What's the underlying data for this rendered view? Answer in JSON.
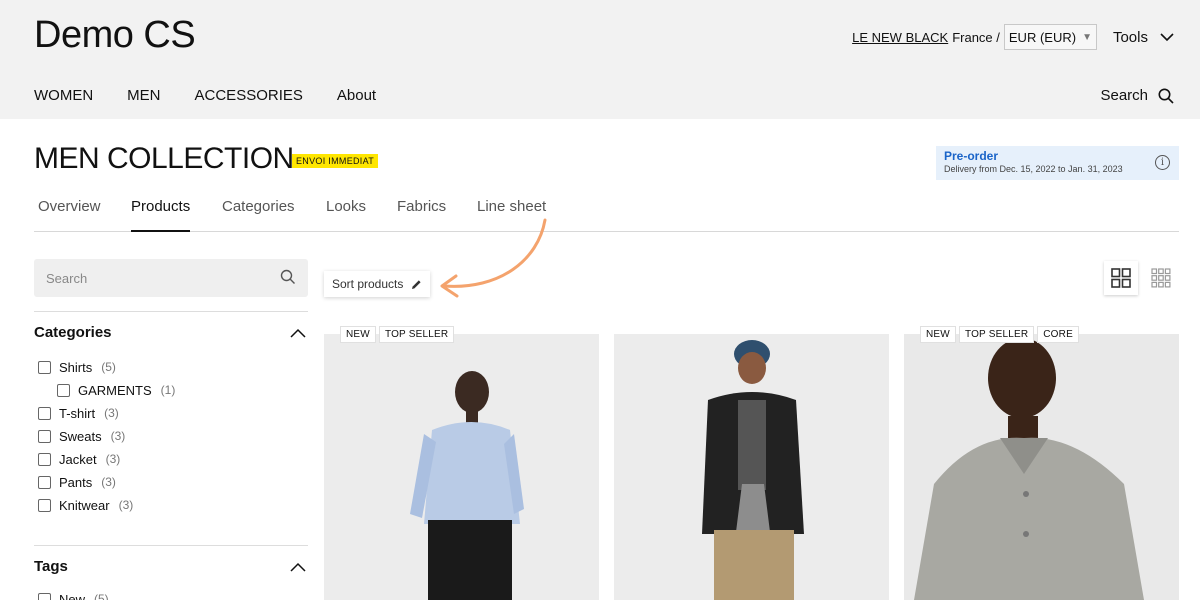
{
  "header": {
    "logo": "Demo CS",
    "brand_link": "LE NEW BLACK",
    "country": "France /",
    "currency": "EUR (EUR)",
    "tools_label": "Tools",
    "nav": [
      "WOMEN",
      "MEN",
      "ACCESSORIES",
      "About"
    ],
    "search_label": "Search"
  },
  "page": {
    "title": "MEN COLLECTION",
    "badge": "ENVOI IMMEDIAT",
    "preorder_title": "Pre-order",
    "preorder_text": "Delivery from Dec. 15, 2022 to Jan. 31, 2023"
  },
  "tabs": {
    "items": [
      "Overview",
      "Products",
      "Categories",
      "Looks",
      "Fabrics",
      "Line sheet"
    ],
    "active": "Products"
  },
  "sidebar": {
    "search_placeholder": "Search",
    "categories_title": "Categories",
    "categories": [
      {
        "label": "Shirts",
        "count": "(5)"
      },
      {
        "label": "GARMENTS",
        "count": "(1)"
      },
      {
        "label": "T-shirt",
        "count": "(3)"
      },
      {
        "label": "Sweats",
        "count": "(3)"
      },
      {
        "label": "Jacket",
        "count": "(3)"
      },
      {
        "label": "Pants",
        "count": "(3)"
      },
      {
        "label": "Knitwear",
        "count": "(3)"
      }
    ],
    "tags_title": "Tags",
    "tags": [
      {
        "label": "New",
        "count": "(5)"
      }
    ]
  },
  "toolbar": {
    "sort_label": "Sort products"
  },
  "products": [
    {
      "badges": [
        "NEW",
        "TOP SELLER"
      ]
    },
    {
      "badges": []
    },
    {
      "badges": [
        "NEW",
        "TOP SELLER",
        "CORE"
      ]
    }
  ],
  "icons": {
    "search": "search-icon",
    "chevron": "chevron-down-icon",
    "info": "info-icon",
    "edit": "pencil-icon",
    "grid_large": "grid-large-icon",
    "grid_small": "grid-small-icon"
  },
  "colors": {
    "header_bg": "#f2f2f2",
    "badge_yellow": "#ffe600",
    "preorder_bg": "#e6f0fb",
    "preorder_accent": "#1a64c8",
    "annotation_arrow": "#f4a36d"
  }
}
